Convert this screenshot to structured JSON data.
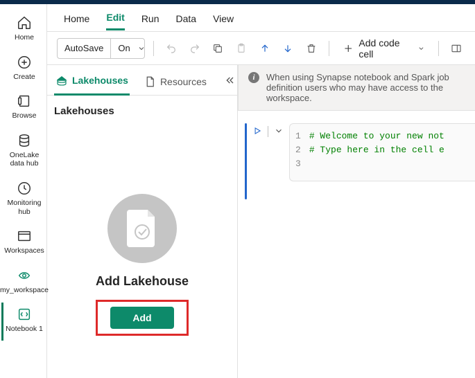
{
  "leftnav": {
    "home": "Home",
    "create": "Create",
    "browse": "Browse",
    "onelake": "OneLake data hub",
    "monitoring": "Monitoring hub",
    "workspaces": "Workspaces",
    "my_workspace": "my_workspace",
    "notebook": "Notebook 1"
  },
  "menubar": {
    "home": "Home",
    "edit": "Edit",
    "run": "Run",
    "data": "Data",
    "view": "View"
  },
  "toolbar": {
    "autosave_label": "AutoSave",
    "autosave_value": "On",
    "addcell": "Add code cell"
  },
  "explorer": {
    "tabs": {
      "lakehouses": "Lakehouses",
      "resources": "Resources"
    },
    "heading": "Lakehouses",
    "empty_title": "Add Lakehouse",
    "add_button": "Add"
  },
  "banner": {
    "text": "When using Synapse notebook and Spark job definition users who may have access to the workspace."
  },
  "cell": {
    "line1": "# Welcome to your new not",
    "line2": "# Type here in the cell e",
    "gutter1": "1",
    "gutter2": "2",
    "gutter3": "3"
  }
}
